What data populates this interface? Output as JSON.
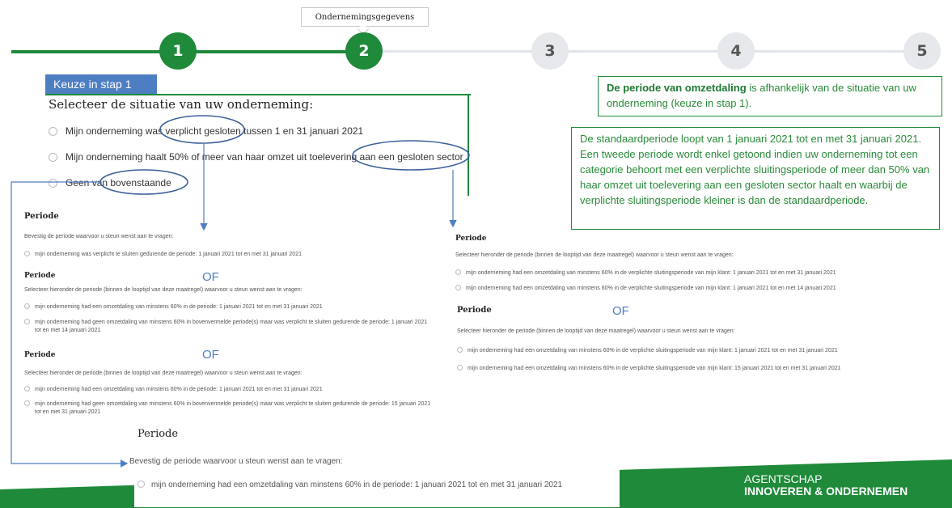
{
  "stepper": {
    "tooltip": "Ondernemingsgegevens",
    "steps": [
      "1",
      "2",
      "3",
      "4",
      "5"
    ],
    "colors": {
      "done": "#1f8a3a",
      "todo": "#e6e8eb"
    }
  },
  "left": {
    "keuze_label": "Keuze in stap 1",
    "question": "Selecteer de situatie van uw onderneming:",
    "options": [
      "Mijn onderneming was verplicht gesloten tussen 1 en 31 januari 2021",
      "Mijn onderneming haalt 50% of meer van haar omzet uit toelevering aan een gesloten sector",
      "Geen van bovenstaande"
    ]
  },
  "info": {
    "box1_bold": "De periode van omzetdaling",
    "box1_rest": " is afhankelijk van de situatie van uw onderneming (keuze in stap 1).",
    "box2": "De standaardperiode loopt van 1  januari 2021 tot en met 31 januari 2021. Een tweede periode wordt enkel getoond indien uw onderneming tot een categorie behoort met een verplichte sluitingsperiode of meer dan 50% van haar omzet uit toelevering aan een gesloten sector haalt en waarbij de verplichte sluitingsperiode kleiner is dan de standaardperiode."
  },
  "left_panels": {
    "p1_title": "Periode",
    "p1_desc": "Bevestig de periode waarvoor u steun wenst aan te vragen:",
    "p1_opt": "mijn onderneming was verplicht te sluiten gedurende de periode: 1 januari 2021 tot en met 31 januari 2021",
    "of": "OF",
    "p2_title": "Periode",
    "p2_desc": "Selecteer hieronder de periode (binnen de looptijd van deze maatregel) waarvoor u steun wenst aan te vragen:",
    "p2_opt1": "mijn onderneming had een omzetdaling van minstens 60% in de periode: 1 januari 2021 tot en met 31 januari 2021",
    "p2_opt2a": "mijn onderneming had geen omzetdaling van minstens 60% in bovenvermelde periode(s) maar was verplicht te sluiten gedurende de periode: 1 januari 2021",
    "p2_opt2b": "tot en met 14 januari 2021",
    "p3_title": "Periode",
    "p3_desc": "Selecteer hieronder de periode (binnen de looptijd van deze maatregel) waarvoor u steun wenst aan te vragen:",
    "p3_opt1": "mijn onderneming had een omzetdaling van minstens 60% in de periode: 1 januari 2021 tot en met 31 januari 2021",
    "p3_opt2a": "mijn onderneming had geen omzetdaling van minstens 60% in bovenvermelde periode(s) maar was verplicht te sluiten gedurende de periode: 15 januari 2021",
    "p3_opt2b": "tot en met 31 januari 2021"
  },
  "right_panels": {
    "r1_title": "Periode",
    "r1_desc": "Selecteer hieronder de periode (binnen de looptijd van deze maatregel) waarvoor u steun wenst aan te vragen:",
    "r1_opt1": "mijn onderneming had een omzetdaling van minstens 60% in de verplichte sluitingsperiode van mijn klant: 1 januari 2021 tot en met 31 januari 2021",
    "r1_opt2": "mijn onderneming had een omzetdaling van minstens 60% in de verplichte sluitingsperiode van mijn klant: 1 januari 2021 tot en met 14 januari 2021",
    "of": "OF",
    "r2_title": "Periode",
    "r2_desc": "Selecteer hieronder de periode (binnen de looptijd van deze maatregel) waarvoor u steun wenst aan te vragen:",
    "r2_opt1": "mijn onderneming had een omzetdaling van minstens 60% in de verplichte sluitingsperiode van mijn klant: 1 januari 2021 tot en met 31 januari 2021",
    "r2_opt2": "mijn onderneming had een omzetdaling van minstens 60% in de verplichte sluitingsperiode van mijn klant: 15 januari 2021 tot en met 31 januari 2021"
  },
  "bottom_panel": {
    "title": "Periode",
    "desc": "Bevestig de periode waarvoor u steun wenst aan te vragen:",
    "opt": "mijn onderneming had een omzetdaling van minstens 60% in de periode: 1 januari 2021 tot en met 31 januari 2021"
  },
  "footer": {
    "agency_line1": "AGENTSCHAP",
    "agency_line2": "INNOVEREN & ONDERNEMEN",
    "brand_green": "#1f8a3a"
  },
  "annotations": {
    "accent": "#4e7ec2"
  }
}
